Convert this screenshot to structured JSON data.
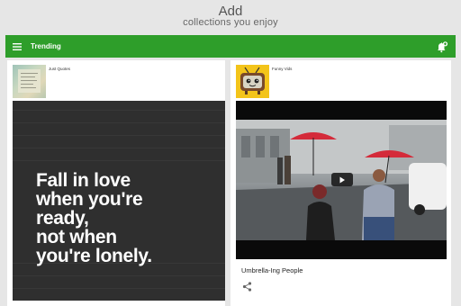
{
  "header": {
    "title": "Add",
    "subtitle": "collections you enjoy"
  },
  "appbar": {
    "title": "Trending",
    "menu_icon": "hamburger-menu-icon",
    "action_icon": "add-alert-icon"
  },
  "cards": [
    {
      "source": "Just Quotes",
      "thumbnail": "quotes-thumbnail",
      "quote": "Fall in love\nwhen you're\nready,\nnot when\nyou're lonely."
    },
    {
      "source": "Funny Vids",
      "thumbnail": "tv-mascot-thumbnail",
      "video_title": "Umbrella-Ing People",
      "share_icon": "share-icon"
    }
  ],
  "colors": {
    "appbar": "#2e9e2a",
    "background": "#e6e6e6",
    "umbrella": "#d42b3a"
  }
}
